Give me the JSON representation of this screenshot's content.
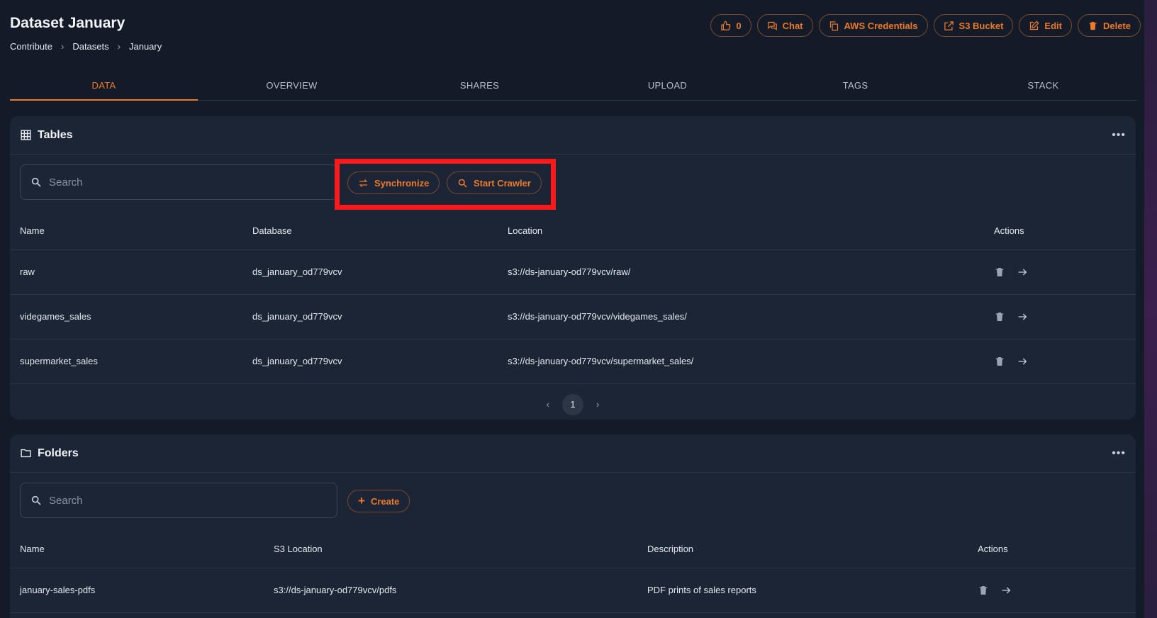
{
  "header": {
    "title": "Dataset January",
    "breadcrumb": [
      "Contribute",
      "Datasets",
      "January"
    ],
    "actions": {
      "likes": "0",
      "chat": "Chat",
      "aws": "AWS Credentials",
      "s3": "S3 Bucket",
      "edit": "Edit",
      "delete": "Delete"
    }
  },
  "tabs": [
    "DATA",
    "OVERVIEW",
    "SHARES",
    "UPLOAD",
    "TAGS",
    "STACK"
  ],
  "tables": {
    "title": "Tables",
    "search_placeholder": "Search",
    "synchronize": "Synchronize",
    "start_crawler": "Start Crawler",
    "columns": [
      "Name",
      "Database",
      "Location",
      "Actions"
    ],
    "rows": [
      {
        "name": "raw",
        "database": "ds_january_od779vcv",
        "location": "s3://ds-january-od779vcv/raw/"
      },
      {
        "name": "videgames_sales",
        "database": "ds_january_od779vcv",
        "location": "s3://ds-january-od779vcv/videgames_sales/"
      },
      {
        "name": "supermarket_sales",
        "database": "ds_january_od779vcv",
        "location": "s3://ds-january-od779vcv/supermarket_sales/"
      }
    ],
    "page": "1"
  },
  "folders": {
    "title": "Folders",
    "search_placeholder": "Search",
    "create": "Create",
    "columns": [
      "Name",
      "S3 Location",
      "Description",
      "Actions"
    ],
    "rows": [
      {
        "name": "january-sales-pdfs",
        "location": "s3://ds-january-od779vcv/pdfs",
        "description": "PDF prints of sales reports"
      }
    ]
  }
}
